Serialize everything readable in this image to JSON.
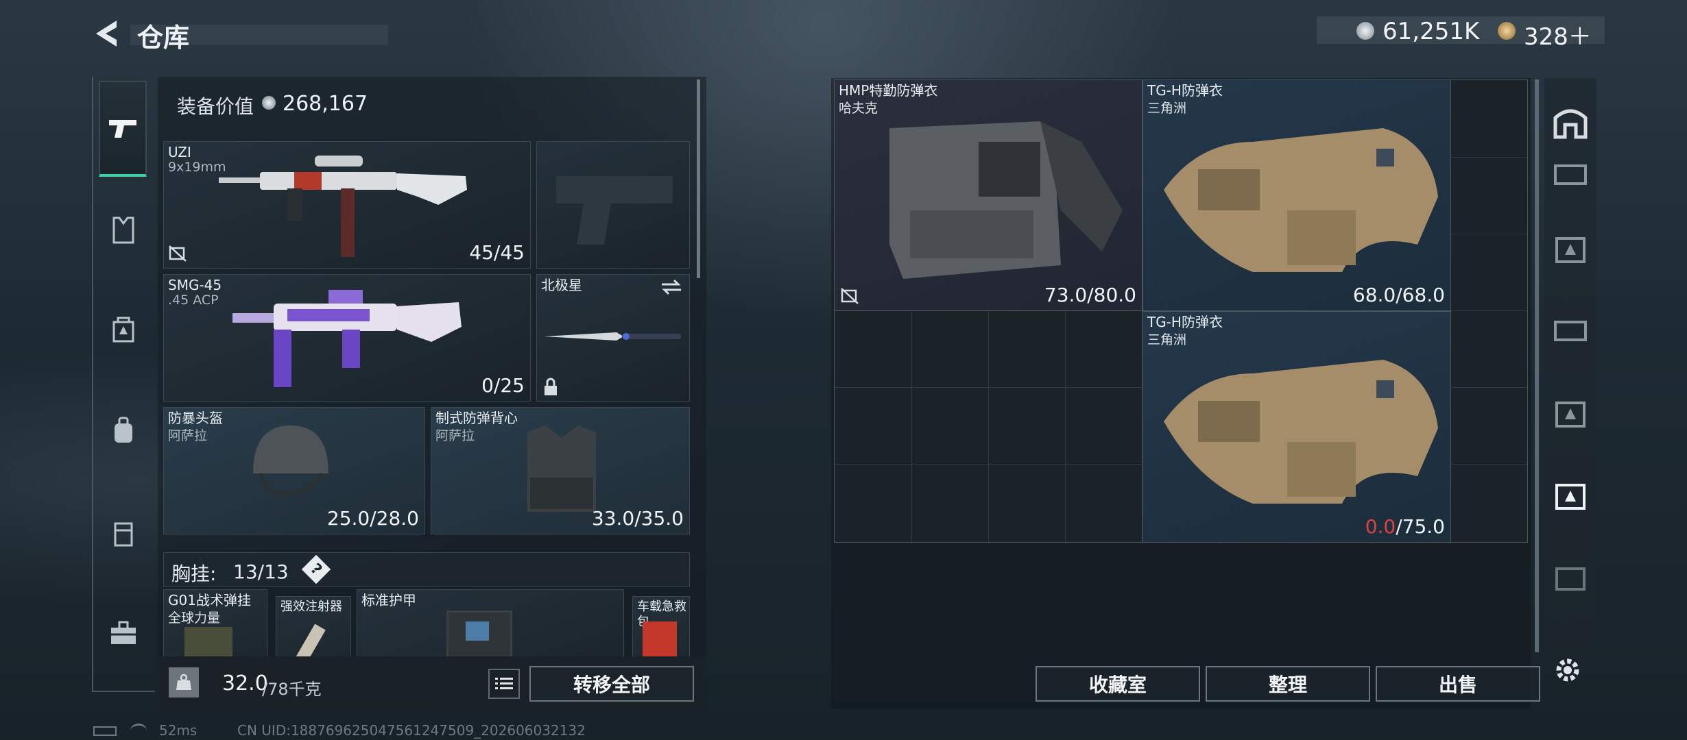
{
  "header": {
    "title": "仓库",
    "currency_1": "61,251K",
    "currency_2": "328＋"
  },
  "left_nav": {
    "icons": [
      "pistol-icon",
      "armor-icon",
      "rig-icon",
      "backpack-icon",
      "pouch-icon",
      "case-icon"
    ]
  },
  "equipment": {
    "value_label": "装备价值",
    "value": "268,167",
    "primary": {
      "name": "UZI",
      "ammo": "9x19mm",
      "count": "45/45"
    },
    "secondary": {
      "name": "SMG-45",
      "ammo": ".45 ACP",
      "count": "0/25"
    },
    "melee": {
      "name": "北极星"
    },
    "helmet": {
      "name": "防暴头盔",
      "brand": "阿萨拉",
      "durability": "25.0/28.0"
    },
    "vest": {
      "name": "制式防弹背心",
      "brand": "阿萨拉",
      "durability": "33.0/35.0"
    },
    "chest_rig": {
      "label": "胸挂:",
      "count": "13/13",
      "help": "?"
    },
    "rig_items": [
      {
        "name": "G01战术弹挂",
        "brand": "全球力量"
      },
      {
        "name": "强效注射器"
      },
      {
        "name": "标准护甲"
      },
      {
        "name": "车载急救包"
      }
    ]
  },
  "footer": {
    "weight": "32.0",
    "weight_max": "/78千克",
    "transfer_all": "转移全部"
  },
  "stash": {
    "items": [
      {
        "name": "HMP特勤防弹衣",
        "brand": "哈夫克",
        "durability": "73.0/80.0"
      },
      {
        "name": "TG-H防弹衣",
        "brand": "三角洲",
        "durability": "68.0/68.0"
      },
      {
        "name": "TG-H防弹衣",
        "brand": "三角洲",
        "durability_current": "0.0",
        "durability_max": "/75.0"
      }
    ],
    "buttons": {
      "collection": "收藏室",
      "sort": "整理",
      "sell": "出售"
    }
  },
  "status": {
    "ping": "52ms",
    "uid": "CN UID:188769625047561247509_202606032132"
  },
  "colors": {
    "accent": "#3fd0a6",
    "danger": "#e04040"
  }
}
